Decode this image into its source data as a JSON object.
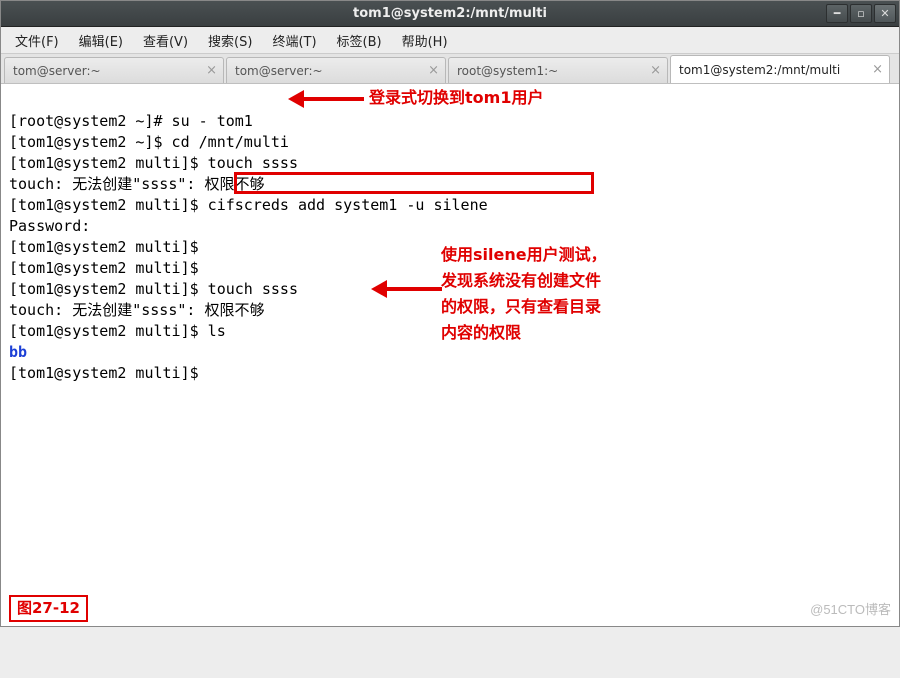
{
  "window": {
    "title": "tom1@system2:/mnt/multi"
  },
  "menubar": [
    "文件(F)",
    "编辑(E)",
    "查看(V)",
    "搜索(S)",
    "终端(T)",
    "标签(B)",
    "帮助(H)"
  ],
  "tabs": [
    {
      "label": "tom@server:~",
      "active": false
    },
    {
      "label": "tom@server:~",
      "active": false
    },
    {
      "label": "root@system1:~",
      "active": false
    },
    {
      "label": "tom1@system2:/mnt/multi",
      "active": true
    }
  ],
  "terminal": {
    "lines": [
      "[root@system2 ~]# su - tom1",
      "[tom1@system2 ~]$ cd /mnt/multi",
      "[tom1@system2 multi]$ touch ssss",
      "touch: 无法创建\"ssss\": 权限不够",
      "[tom1@system2 multi]$ cifscreds add system1 -u silene",
      "Password:",
      "[tom1@system2 multi]$ ",
      "[tom1@system2 multi]$ ",
      "[tom1@system2 multi]$ touch ssss",
      "touch: 无法创建\"ssss\": 权限不够",
      "[tom1@system2 multi]$ ls",
      "bb",
      "[tom1@system2 multi]$ "
    ]
  },
  "annotations": {
    "arrow1_label": "登录式切换到tom1用户",
    "block2_lines": [
      "使用silene用户测试，",
      "发现系统没有创建文件",
      "的权限，只有查看目录",
      "内容的权限"
    ],
    "figure_label": "图27-12"
  },
  "watermark": "@51CTO博客"
}
